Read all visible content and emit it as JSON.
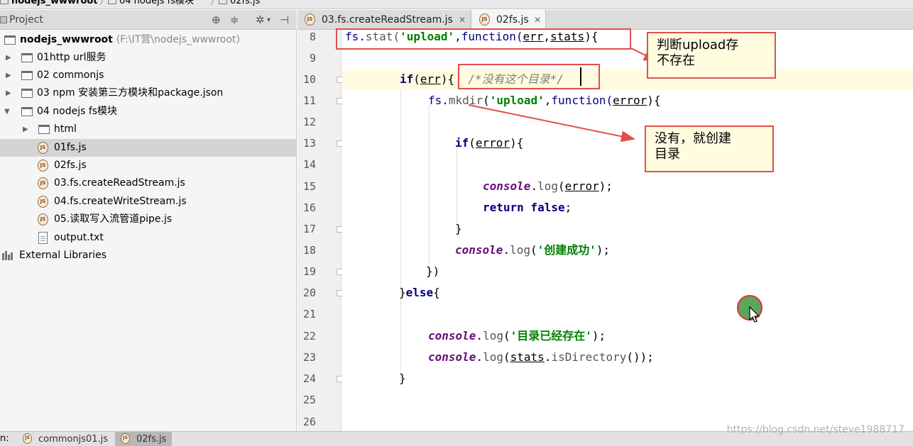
{
  "breadcrumb": {
    "project": "nodejs_wwwroot",
    "folder": "04 nodejs fs模块",
    "file": "02fs.js"
  },
  "project_panel": {
    "title": "Project",
    "items": [
      {
        "label": "nodejs_wwwroot",
        "path": "(F:\\IT营\\nodejs_wwwroot)",
        "type": "folder",
        "expanded": true
      },
      {
        "label": "01http url服务",
        "type": "folder",
        "expanded": false
      },
      {
        "label": "02 commonjs",
        "type": "folder",
        "expanded": false
      },
      {
        "label": "03 npm 安装第三方模块和package.json",
        "type": "folder",
        "expanded": false
      },
      {
        "label": "04 nodejs fs模块",
        "type": "folder",
        "expanded": true
      },
      {
        "label": "html",
        "type": "folder",
        "expanded": false
      },
      {
        "label": "01fs.js",
        "type": "js",
        "selected": true
      },
      {
        "label": "02fs.js",
        "type": "js"
      },
      {
        "label": "03.fs.createReadStream.js",
        "type": "js"
      },
      {
        "label": "04.fs.createWriteStream.js",
        "type": "js"
      },
      {
        "label": "05.读取写入流管道pipe.js",
        "type": "js"
      },
      {
        "label": "output.txt",
        "type": "txt"
      },
      {
        "label": "External Libraries",
        "type": "lib"
      }
    ]
  },
  "editor": {
    "tabs": [
      {
        "label": "03.fs.createReadStream.js",
        "active": false
      },
      {
        "label": "02fs.js",
        "active": true
      }
    ],
    "icon_text": "JS",
    "line_numbers": [
      "8",
      "9",
      "10",
      "11",
      "12",
      "13",
      "14",
      "15",
      "16",
      "17",
      "18",
      "19",
      "20",
      "21",
      "22",
      "23",
      "24",
      "25",
      "26"
    ],
    "code": {
      "l8_a": "fs.",
      "l8_b": "stat(",
      "l8_c": "'upload'",
      "l8_d": ",function(",
      "l8_e": "err",
      "l8_f": ",",
      "l8_g": "stats",
      "l8_h": "){",
      "l10_kw": "if",
      "l10_a": "(",
      "l10_b": "err",
      "l10_c": "){",
      "l10_cmt": "/*没有这个目录*/",
      "l11_a": "fs.",
      "l11_b": "mkdir",
      "l11_c": "(",
      "l11_d": "'upload'",
      "l11_e": ",function(",
      "l11_f": "error",
      "l11_g": "){",
      "l13_kw": "if",
      "l13_a": "(",
      "l13_b": "error",
      "l13_c": "){",
      "l15_con": "console",
      "l15_a": ".",
      "l15_b": "log",
      "l15_c": "(",
      "l15_d": "error",
      "l15_e": ");",
      "l16_kw": "return false",
      "l16_a": ";",
      "l17": "}",
      "l18_con": "console",
      "l18_a": ".",
      "l18_b": "log",
      "l18_c": "(",
      "l18_str": "'创建成功'",
      "l18_d": ");",
      "l19": "})",
      "l20_a": "}",
      "l20_kw": "else",
      "l20_b": "{",
      "l22_con": "console",
      "l22_a": ".",
      "l22_b": "log",
      "l22_c": "(",
      "l22_str": "'目录已经存在'",
      "l22_d": ");",
      "l23_con": "console",
      "l23_a": ".",
      "l23_b": "log",
      "l23_c": "(",
      "l23_d": "stats",
      "l23_e": ".",
      "l23_f": "isDirectory",
      "l23_g": "());",
      "l24": "}"
    }
  },
  "annotations": {
    "callout_1": "判断upload存\n不存在",
    "callout_2": "没有，就创建\n目录",
    "border_color": "#e0504a",
    "fill_color": "#fffce0"
  },
  "bottom_bar": {
    "prefix": "n:",
    "tabs": [
      {
        "label": "commonjs01.js",
        "active": false
      },
      {
        "label": "02fs.js",
        "active": true
      }
    ]
  },
  "watermark": "https://blog.csdn.net/steve1988717"
}
